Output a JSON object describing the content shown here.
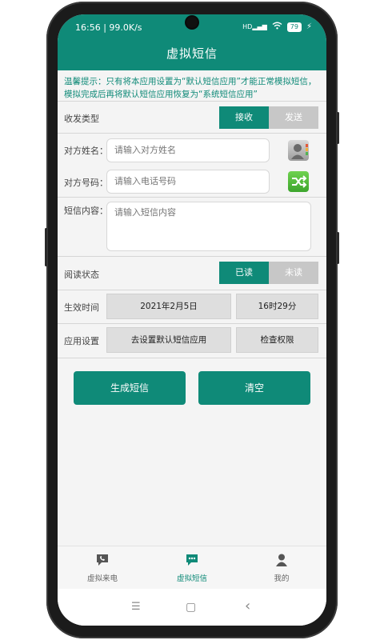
{
  "status_bar": {
    "time": "16:56 | 99.0K/s",
    "signal": "HD",
    "battery": "79"
  },
  "app": {
    "title": "虚拟短信",
    "accent_color": "#0f8a78"
  },
  "tip": "温馨提示：只有将本应用设置为“默认短信应用”才能正常模拟短信，模拟完成后再将默认短信应用恢复为“系统短信应用”",
  "form": {
    "direction_label": "收发类型",
    "receive_label": "接收",
    "send_label": "发送",
    "name_label": "对方姓名：",
    "name_placeholder": "请输入对方姓名",
    "name_value": "",
    "phone_label": "对方号码：",
    "phone_placeholder": "请输入电话号码",
    "phone_value": "",
    "content_label": "短信内容：",
    "content_placeholder": "请输入短信内容",
    "content_value": "",
    "read_label": "阅读状态",
    "read_on_label": "已读",
    "read_off_label": "未读",
    "time_label": "生效时间",
    "date_value": "2021年2月5日",
    "time_value": "16时29分",
    "settings_label": "应用设置",
    "set_default_label": "去设置默认短信应用",
    "check_perm_label": "检查权限"
  },
  "actions": {
    "generate_label": "生成短信",
    "clear_label": "清空"
  },
  "bottom_nav": [
    {
      "label": "虚拟来电",
      "icon": "chat-phone-icon",
      "active": false
    },
    {
      "label": "虚拟短信",
      "icon": "message-icon",
      "active": true
    },
    {
      "label": "我的",
      "icon": "person-icon",
      "active": false
    }
  ],
  "system_nav": {
    "menu_glyph": "☰",
    "home_glyph": "▢",
    "back_glyph": "‹"
  }
}
